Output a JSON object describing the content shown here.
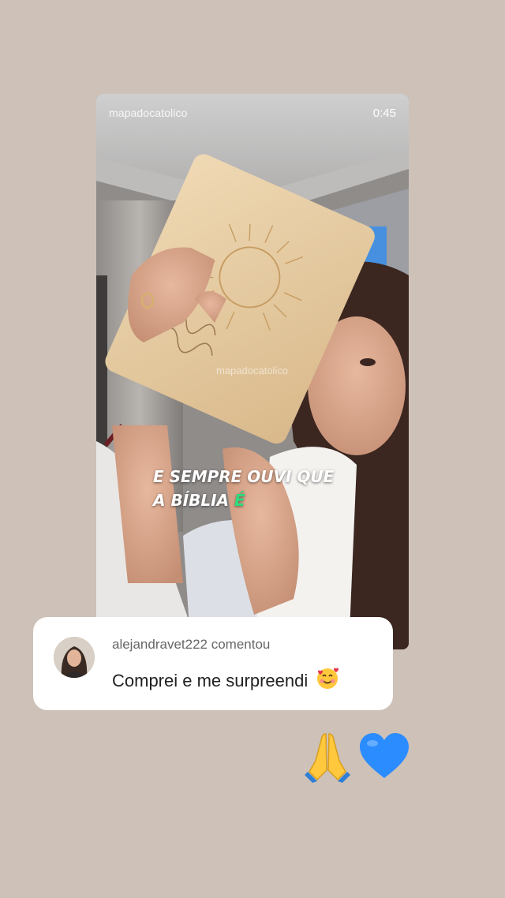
{
  "story": {
    "author": "mapadocatolico",
    "duration": "0:45",
    "watermark": "mapadocatolico",
    "caption_line1": "E SEMPRE OUVI QUE",
    "caption_line2_prefix": "A BÍBLIA",
    "caption_line2_highlight": "É",
    "caption_highlight_color": "#2ddc7b"
  },
  "comment": {
    "username": "alejandravet222",
    "action": "comentou",
    "text": "Comprei e me surpreendi",
    "emoji": "smiling-face-with-hearts-icon"
  },
  "reactions": [
    {
      "name": "folded-hands-icon"
    },
    {
      "name": "blue-heart-icon",
      "color": "#2b8cff"
    }
  ],
  "background_color": "#cdc1b8"
}
